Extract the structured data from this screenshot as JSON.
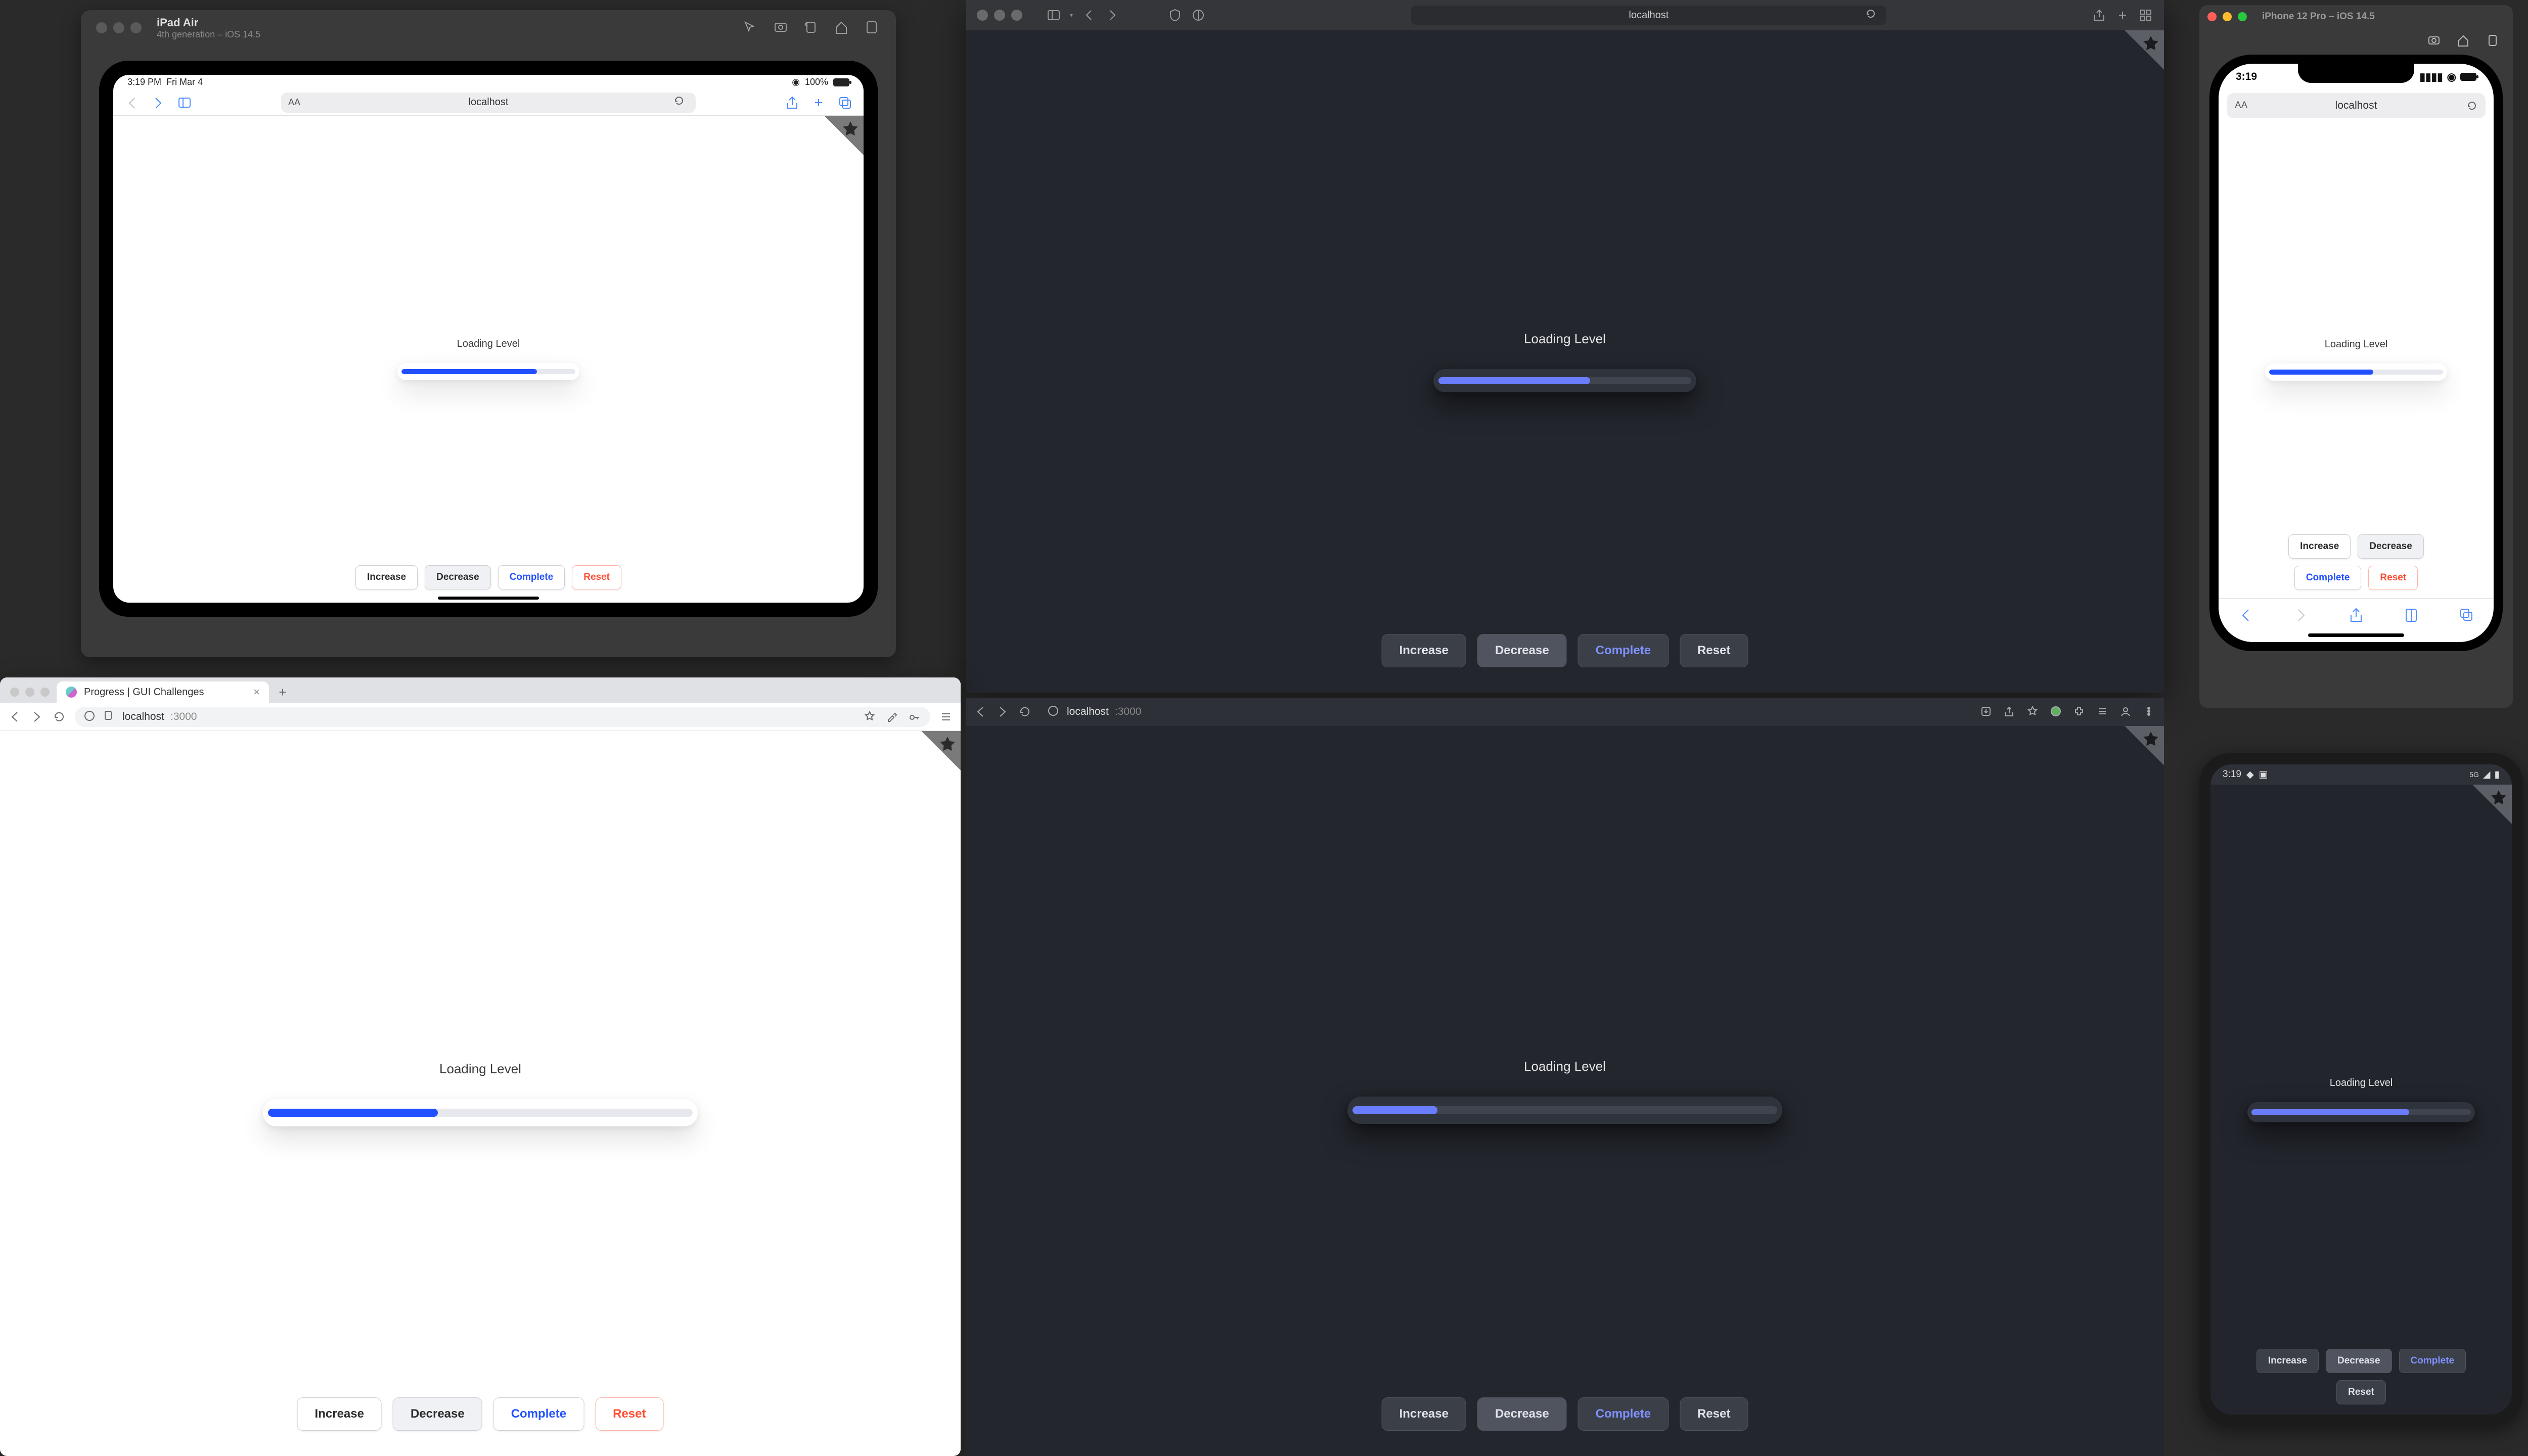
{
  "demo": {
    "label": "Loading Level",
    "buttons": {
      "increase": "Increase",
      "decrease": "Decrease",
      "complete": "Complete",
      "reset": "Reset"
    }
  },
  "ipad": {
    "device": "iPad Air",
    "subtitle": "4th generation – iOS 14.5",
    "status_time": "3:19 PM",
    "status_date": "Fri Mar 4",
    "battery": "100%",
    "address": "localhost",
    "progress_pct": 78
  },
  "safari_main": {
    "address": "localhost",
    "progress_pct": 60
  },
  "iphone": {
    "device": "iPhone 12 Pro – iOS 14.5",
    "status_time": "3:19",
    "address": "localhost",
    "progress_pct": 60
  },
  "chrome_light": {
    "tab_title": "Progress | GUI Challenges",
    "address_host": "localhost",
    "address_port": ":3000",
    "progress_pct": 40,
    "active_button": "decrease"
  },
  "chrome_dark": {
    "address_host": "localhost",
    "address_port": ":3000",
    "progress_pct": 20
  },
  "android": {
    "status_time": "3:19",
    "progress_pct": 72,
    "active_button": "decrease"
  },
  "colors": {
    "accent_light": "#2250ff",
    "accent_dark": "#6a7dff",
    "danger": "#ff4d33"
  }
}
